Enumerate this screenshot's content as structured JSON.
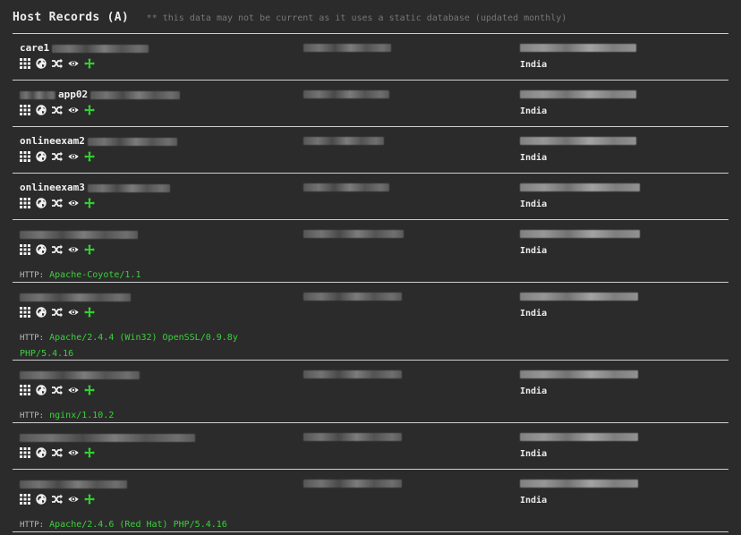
{
  "header": {
    "title": "Host Records (A)",
    "note": "** this data may not be current as it uses a static database (updated monthly)"
  },
  "http_label": "HTTP:",
  "records": [
    {
      "host": "care1",
      "country": "India",
      "http": ""
    },
    {
      "host": "app02",
      "country": "India",
      "http": ""
    },
    {
      "host": "onlineexam2",
      "country": "India",
      "http": ""
    },
    {
      "host": "onlineexam3",
      "country": "India",
      "http": ""
    },
    {
      "host": "",
      "country": "India",
      "http": "Apache-Coyote/1.1"
    },
    {
      "host": "",
      "country": "India",
      "http": "Apache/2.4.4 (Win32) OpenSSL/0.9.8y PHP/5.4.16"
    },
    {
      "host": "",
      "country": "India",
      "http": "nginx/1.10.2"
    },
    {
      "host": "",
      "country": "India",
      "http": ""
    },
    {
      "host": "",
      "country": "India",
      "http": "Apache/2.4.6 (Red Hat) PHP/5.4.16"
    }
  ],
  "icons": [
    "grid-icon",
    "globe-icon",
    "shuffle-icon",
    "eye-icon",
    "crosshair-icon"
  ],
  "colors": {
    "accent": "#3bd13b",
    "background": "#2b2b2b",
    "divider": "#cfcfcf"
  }
}
